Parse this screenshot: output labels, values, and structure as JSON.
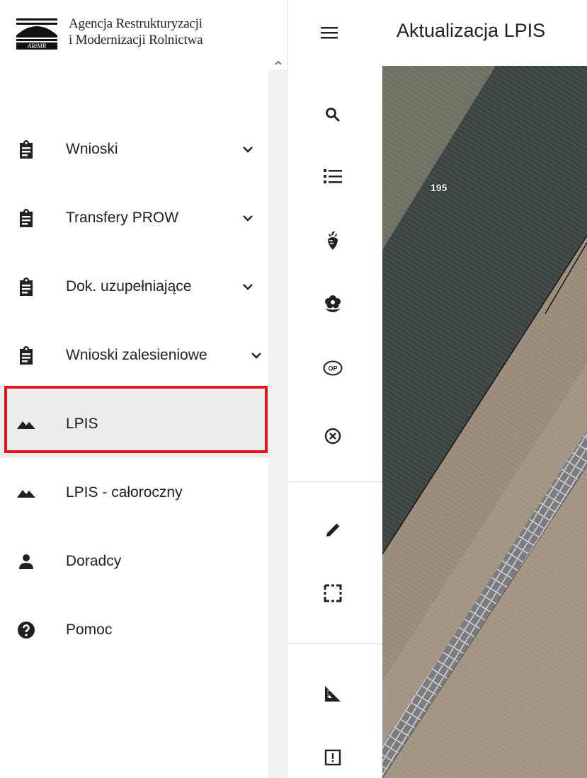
{
  "brand": {
    "line1": "Agencja Restrukturyzacji",
    "line2": "i Modernizacji Rolnictwa",
    "logo_text": "ARiMR"
  },
  "header": {
    "title": "Aktualizacja LPIS",
    "menu_icon": "hamburger-menu-icon"
  },
  "sidebar": {
    "items": [
      {
        "label": "Wnioski",
        "icon": "clipboard-icon",
        "expandable": true
      },
      {
        "label": "Transfery PROW",
        "icon": "clipboard-icon",
        "expandable": true
      },
      {
        "label": "Dok. uzupełniające",
        "icon": "clipboard-icon",
        "expandable": true
      },
      {
        "label": "Wnioski zalesieniowe",
        "icon": "clipboard-icon",
        "expandable": true
      },
      {
        "label": "LPIS",
        "icon": "terrain-icon",
        "expandable": false,
        "active": true
      },
      {
        "label": "LPIS - całoroczny",
        "icon": "terrain-icon",
        "expandable": false
      },
      {
        "label": "Doradcy",
        "icon": "person-icon",
        "expandable": false
      },
      {
        "label": "Pomoc",
        "icon": "help-icon",
        "expandable": false
      }
    ]
  },
  "tools": [
    {
      "name": "search-tool",
      "icon": "search-icon"
    },
    {
      "name": "list-tool",
      "icon": "list-icon"
    },
    {
      "name": "crop-tool",
      "icon": "beet-icon"
    },
    {
      "name": "flower-tool",
      "icon": "flower-icon"
    },
    {
      "name": "op-tool",
      "icon": "op-badge-icon",
      "text": "OP"
    },
    {
      "name": "cancel-tool",
      "icon": "cancel-circle-icon"
    },
    {
      "name": "edit-tool",
      "icon": "pencil-icon"
    },
    {
      "name": "select-area-tool",
      "icon": "dashed-select-icon"
    },
    {
      "name": "measure-tool",
      "icon": "ruler-triangle-icon"
    },
    {
      "name": "report-tool",
      "icon": "alert-box-icon"
    }
  ],
  "map": {
    "parcel_label": "195"
  },
  "colors": {
    "highlight": "#e3131b",
    "active_bg": "#ececec"
  }
}
